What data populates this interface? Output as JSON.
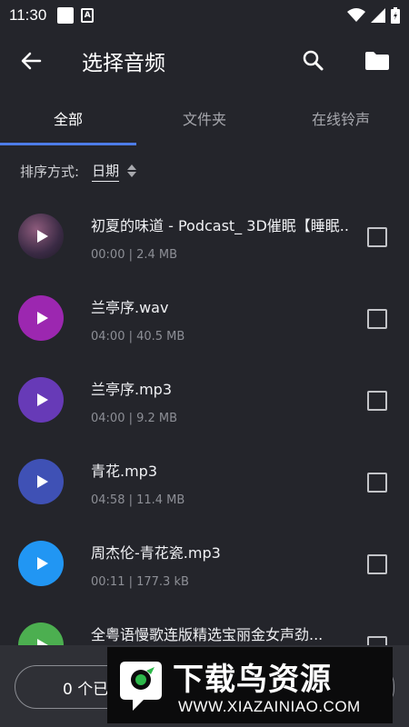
{
  "status_bar": {
    "time": "11:30",
    "battery_level": 0.8
  },
  "toolbar": {
    "title": "选择音频",
    "back_icon": "arrow-left-icon",
    "search_icon": "search-icon",
    "folder_icon": "folder-icon"
  },
  "tabs": [
    {
      "label": "全部",
      "active": true
    },
    {
      "label": "文件夹",
      "active": false
    },
    {
      "label": "在线铃声",
      "active": false
    }
  ],
  "sort": {
    "label": "排序方式:",
    "value": "日期"
  },
  "items": [
    {
      "title": "初夏的味道 - Podcast_ 3D催眠【睡眠...",
      "meta": "00:00 | 2.4 MB",
      "color": "#5a3c5e",
      "checked": false
    },
    {
      "title": "兰亭序.wav",
      "meta": "04:00 | 40.5 MB",
      "color": "#9c27b0",
      "checked": false
    },
    {
      "title": "兰亭序.mp3",
      "meta": "04:00 | 9.2 MB",
      "color": "#673ab7",
      "checked": false
    },
    {
      "title": "青花.mp3",
      "meta": "04:58 | 11.4 MB",
      "color": "#3f51b5",
      "checked": false
    },
    {
      "title": "周杰伦-青花瓷.mp3",
      "meta": "00:11 | 177.3 kB",
      "color": "#2196f3",
      "checked": false
    },
    {
      "title": "全粤语慢歌连版精选宝丽金女声劲...",
      "meta": "",
      "color": "#4caf50",
      "checked": false
    }
  ],
  "bottom": {
    "selected_label": "0 个已"
  },
  "watermark": {
    "text": "下载鸟资源",
    "url": "WWW.XIAZAINIAO.COM"
  }
}
